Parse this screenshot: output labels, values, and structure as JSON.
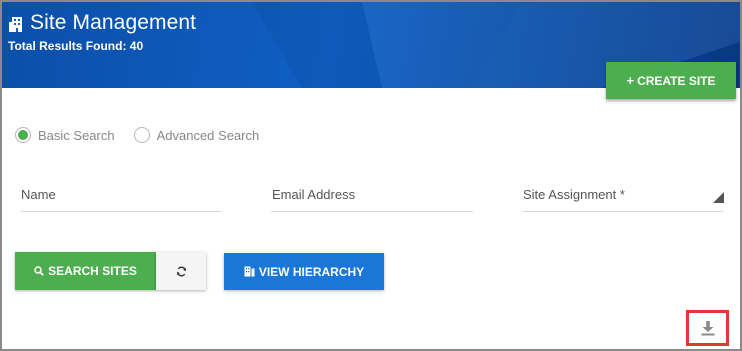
{
  "header": {
    "title": "Site Management",
    "results_label": "Total Results Found: 40",
    "icon": "building-icon"
  },
  "actions": {
    "create_label": "CREATE SITE",
    "create_icon": "plus-icon"
  },
  "search_mode": {
    "options": [
      "Basic Search",
      "Advanced Search"
    ],
    "selected": "Basic Search"
  },
  "fields": {
    "name": {
      "label": "Name",
      "value": ""
    },
    "email": {
      "label": "Email Address",
      "value": ""
    },
    "site_assignment": {
      "label": "Site Assignment *",
      "value": ""
    }
  },
  "buttons": {
    "search_label": "SEARCH SITES",
    "search_icon": "search-icon",
    "refresh_icon": "refresh-icon",
    "hierarchy_label": "VIEW HIERARCHY",
    "hierarchy_icon": "sitemap-icon"
  },
  "download": {
    "icon": "download-icon"
  },
  "colors": {
    "header_blue": "#0f5fc4",
    "green": "#4cae4f",
    "blue_button": "#1b77d7",
    "highlight_red": "#de3a36"
  }
}
